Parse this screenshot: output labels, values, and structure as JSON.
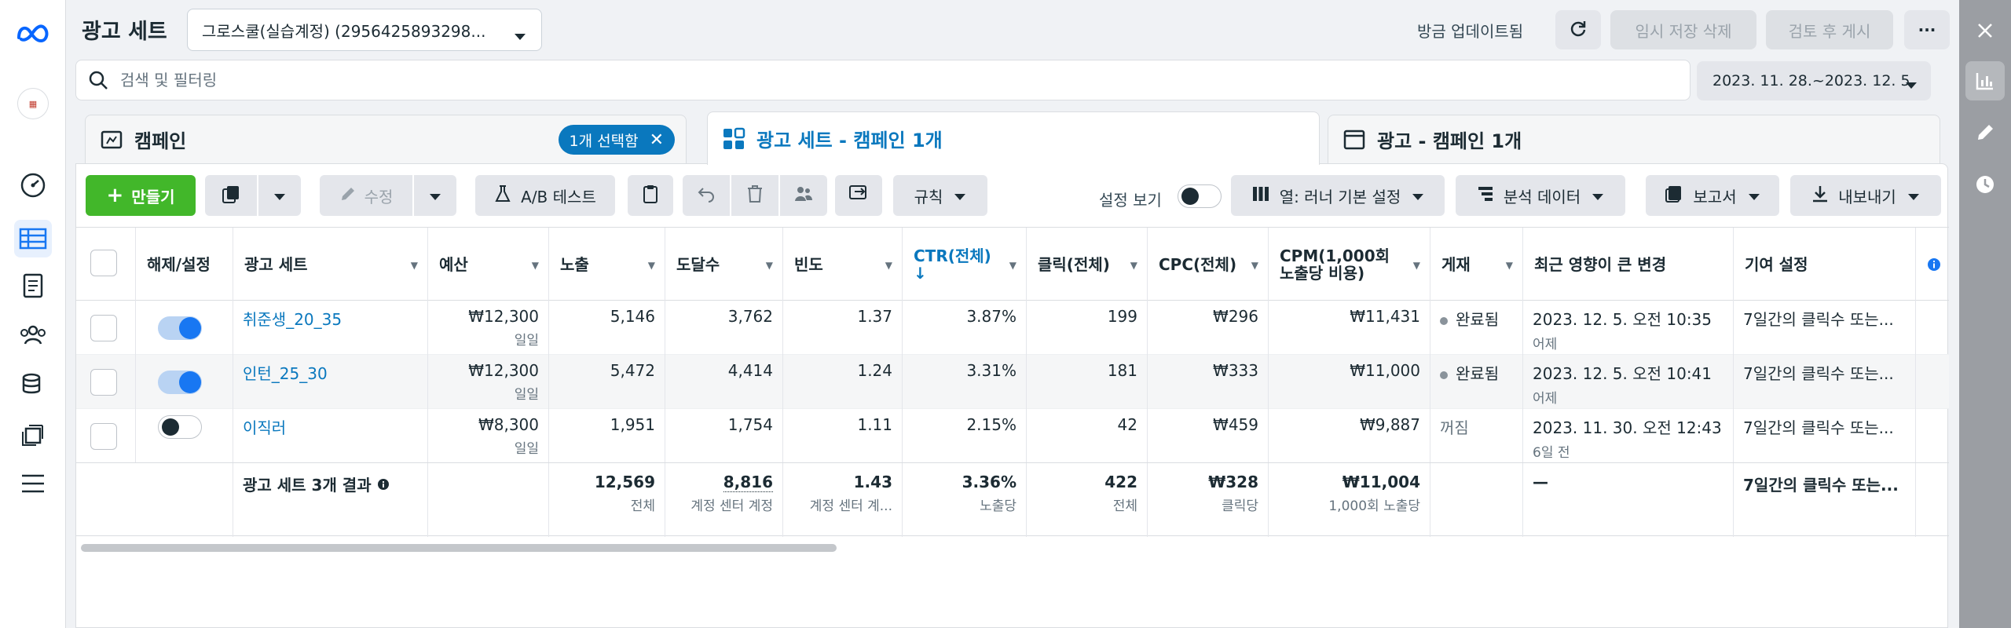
{
  "header": {
    "title": "광고 세트",
    "account": "그로스쿨(실습계정) (2956425893298...",
    "updated": "방금 업데이트됨",
    "discard_label": "임시 저장 삭제",
    "review_label": "검토 후 게시",
    "more_label": "···"
  },
  "search": {
    "placeholder": "검색 및 필터링",
    "date_range": "2023. 11. 28.~2023. 12. 5."
  },
  "tabs": {
    "campaign": "캠페인",
    "selected_pill": "1개 선택함",
    "adset": "광고 세트 - 캠페인 1개",
    "ad": "광고 - 캠페인 1개"
  },
  "toolbar": {
    "create": "만들기",
    "edit": "수정",
    "ab_test": "A/B 테스트",
    "rules": "규칙",
    "view_settings": "설정 보기",
    "columns": "열: 러너 기본 설정",
    "breakdown": "분석 데이터",
    "reports": "보고서",
    "export": "내보내기"
  },
  "table": {
    "headers": {
      "toggle": "해제/설정",
      "adset": "광고 세트",
      "budget": "예산",
      "impressions": "노출",
      "reach": "도달수",
      "frequency": "빈도",
      "ctr": "CTR(전체)",
      "ctr_arrow": "↓",
      "clicks": "클릭(전체)",
      "cpc": "CPC(전체)",
      "cpm": "CPM(1,000회 노출당 비용)",
      "delivery": "게재",
      "recent_change": "최근 영향이 큰 변경",
      "attribution": "기여 설정"
    },
    "rows": [
      {
        "on": true,
        "name": "취준생_20_35",
        "budget": "₩12,300",
        "budget_period": "일일",
        "impressions": "5,146",
        "reach": "3,762",
        "frequency": "1.37",
        "ctr": "3.87%",
        "clicks": "199",
        "cpc": "₩296",
        "cpm": "₩11,431",
        "delivery": "완료됨",
        "change_date": "2023. 12. 5. 오전 10:35",
        "change_rel": "어제",
        "attribution": "7일간의 클릭수 또는..."
      },
      {
        "on": true,
        "name": "인턴_25_30",
        "budget": "₩12,300",
        "budget_period": "일일",
        "impressions": "5,472",
        "reach": "4,414",
        "frequency": "1.24",
        "ctr": "3.31%",
        "clicks": "181",
        "cpc": "₩333",
        "cpm": "₩11,000",
        "delivery": "완료됨",
        "change_date": "2023. 12. 5. 오전 10:41",
        "change_rel": "어제",
        "attribution": "7일간의 클릭수 또는..."
      },
      {
        "on": false,
        "name": "이직러",
        "budget": "₩8,300",
        "budget_period": "일일",
        "impressions": "1,951",
        "reach": "1,754",
        "frequency": "1.11",
        "ctr": "2.15%",
        "clicks": "42",
        "cpc": "₩459",
        "cpm": "₩9,887",
        "delivery": "꺼짐",
        "change_date": "2023. 11. 30. 오전 12:43",
        "change_rel": "6일 전",
        "attribution": "7일간의 클릭수 또는..."
      }
    ],
    "summary": {
      "label": "광고 세트 3개 결과",
      "impressions": "12,569",
      "impressions_sub": "전체",
      "reach": "8,816",
      "reach_sub": "계정 센터 계정",
      "frequency": "1.43",
      "frequency_sub": "계정 센터 계...",
      "ctr": "3.36%",
      "ctr_sub": "노출당",
      "clicks": "422",
      "clicks_sub": "전체",
      "cpc": "₩328",
      "cpc_sub": "클릭당",
      "cpm": "₩11,004",
      "cpm_sub": "1,000회 노출당",
      "recent_change": "—",
      "attribution": "7일간의 클릭수 또는..."
    }
  },
  "colors": {
    "accent": "#0a78be",
    "create": "#42b72a",
    "toggle_on": "#1877f2"
  }
}
